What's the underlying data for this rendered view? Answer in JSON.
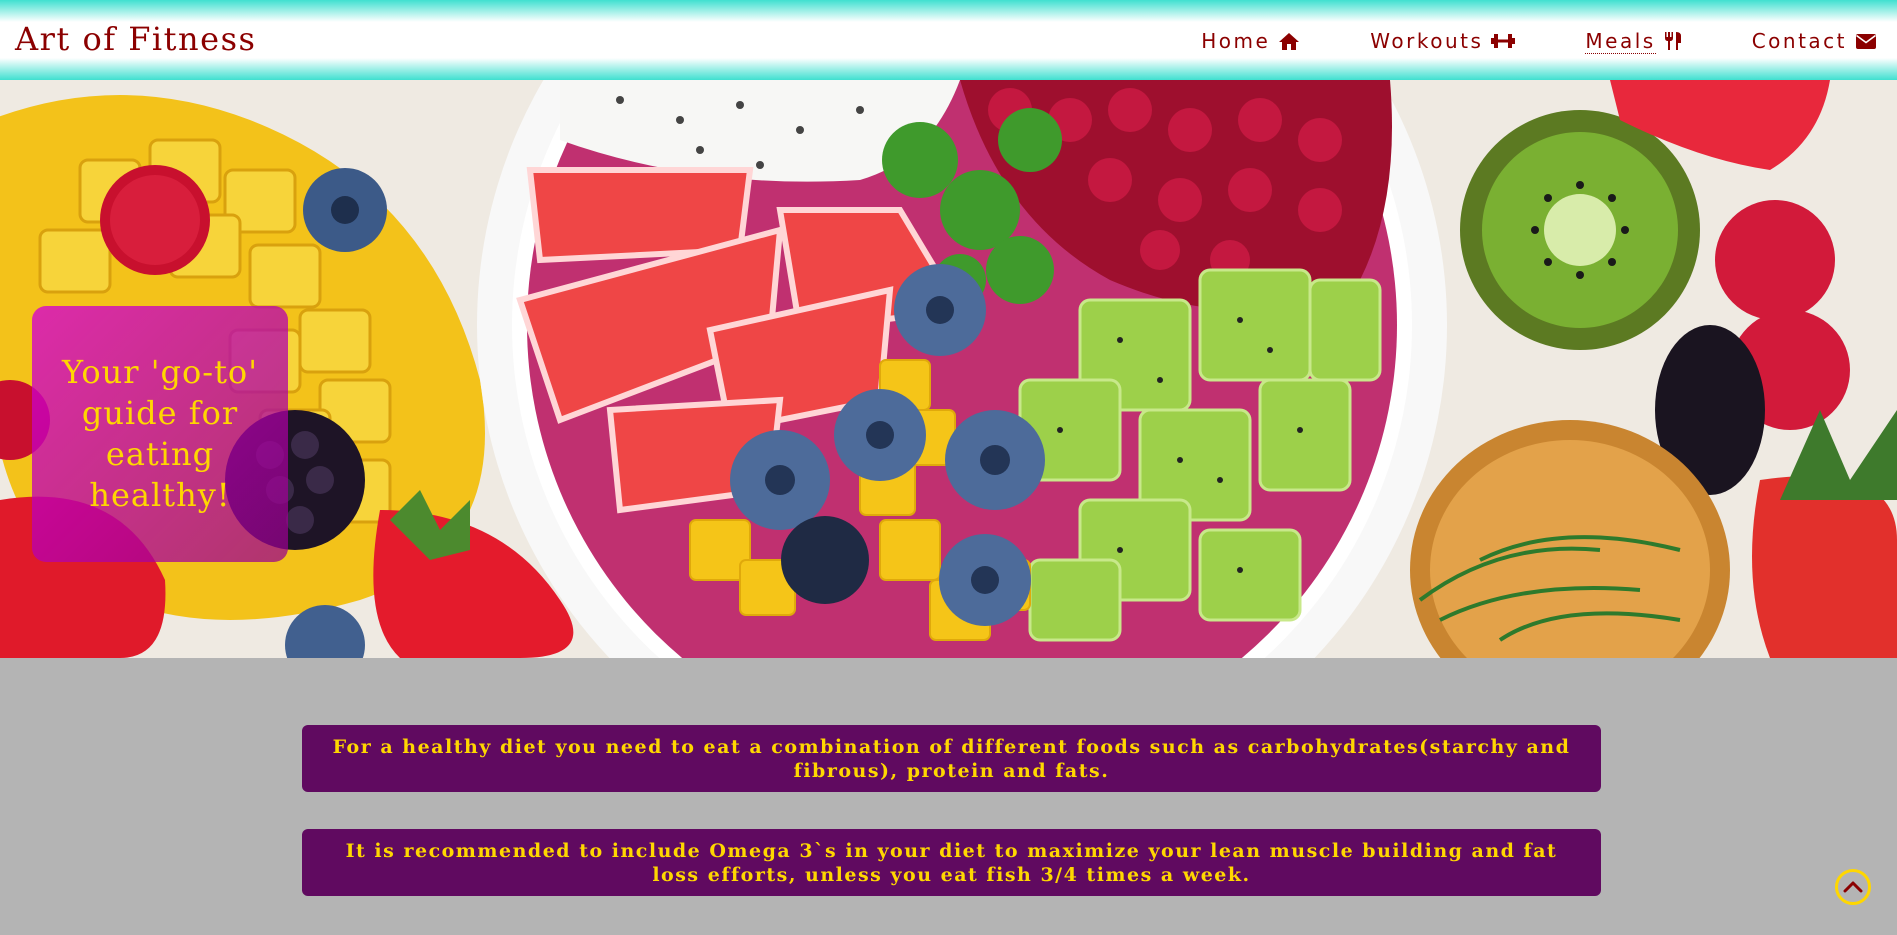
{
  "header": {
    "brand": "Art of Fitness",
    "nav": [
      {
        "label": "Home",
        "icon": "home-icon",
        "active": false
      },
      {
        "label": "Workouts",
        "icon": "dumbbell-icon",
        "active": false
      },
      {
        "label": "Meals",
        "icon": "utensils-icon",
        "active": true
      },
      {
        "label": "Contact",
        "icon": "envelope-icon",
        "active": false
      }
    ]
  },
  "hero": {
    "image": "fruit-bowl-photo",
    "tagline": "Your 'go-to' guide for eating healthy!"
  },
  "tips": [
    "For a healthy diet you need to eat a combination of different foods such as carbohydrates(starchy and fibrous), protein and fats.",
    "It is recommended to include Omega 3`s in your diet to maximize your lean muscle building and fat loss efforts, unless you eat fish 3/4 times a week."
  ],
  "colors": {
    "brand": "#8b0000",
    "accent": "#ffd700",
    "tip_background": "#600a60",
    "header_gradient": "#40e0d0",
    "page_background": "#b4b4b4"
  },
  "back_to_top": {
    "icon": "chevron-up-icon"
  }
}
